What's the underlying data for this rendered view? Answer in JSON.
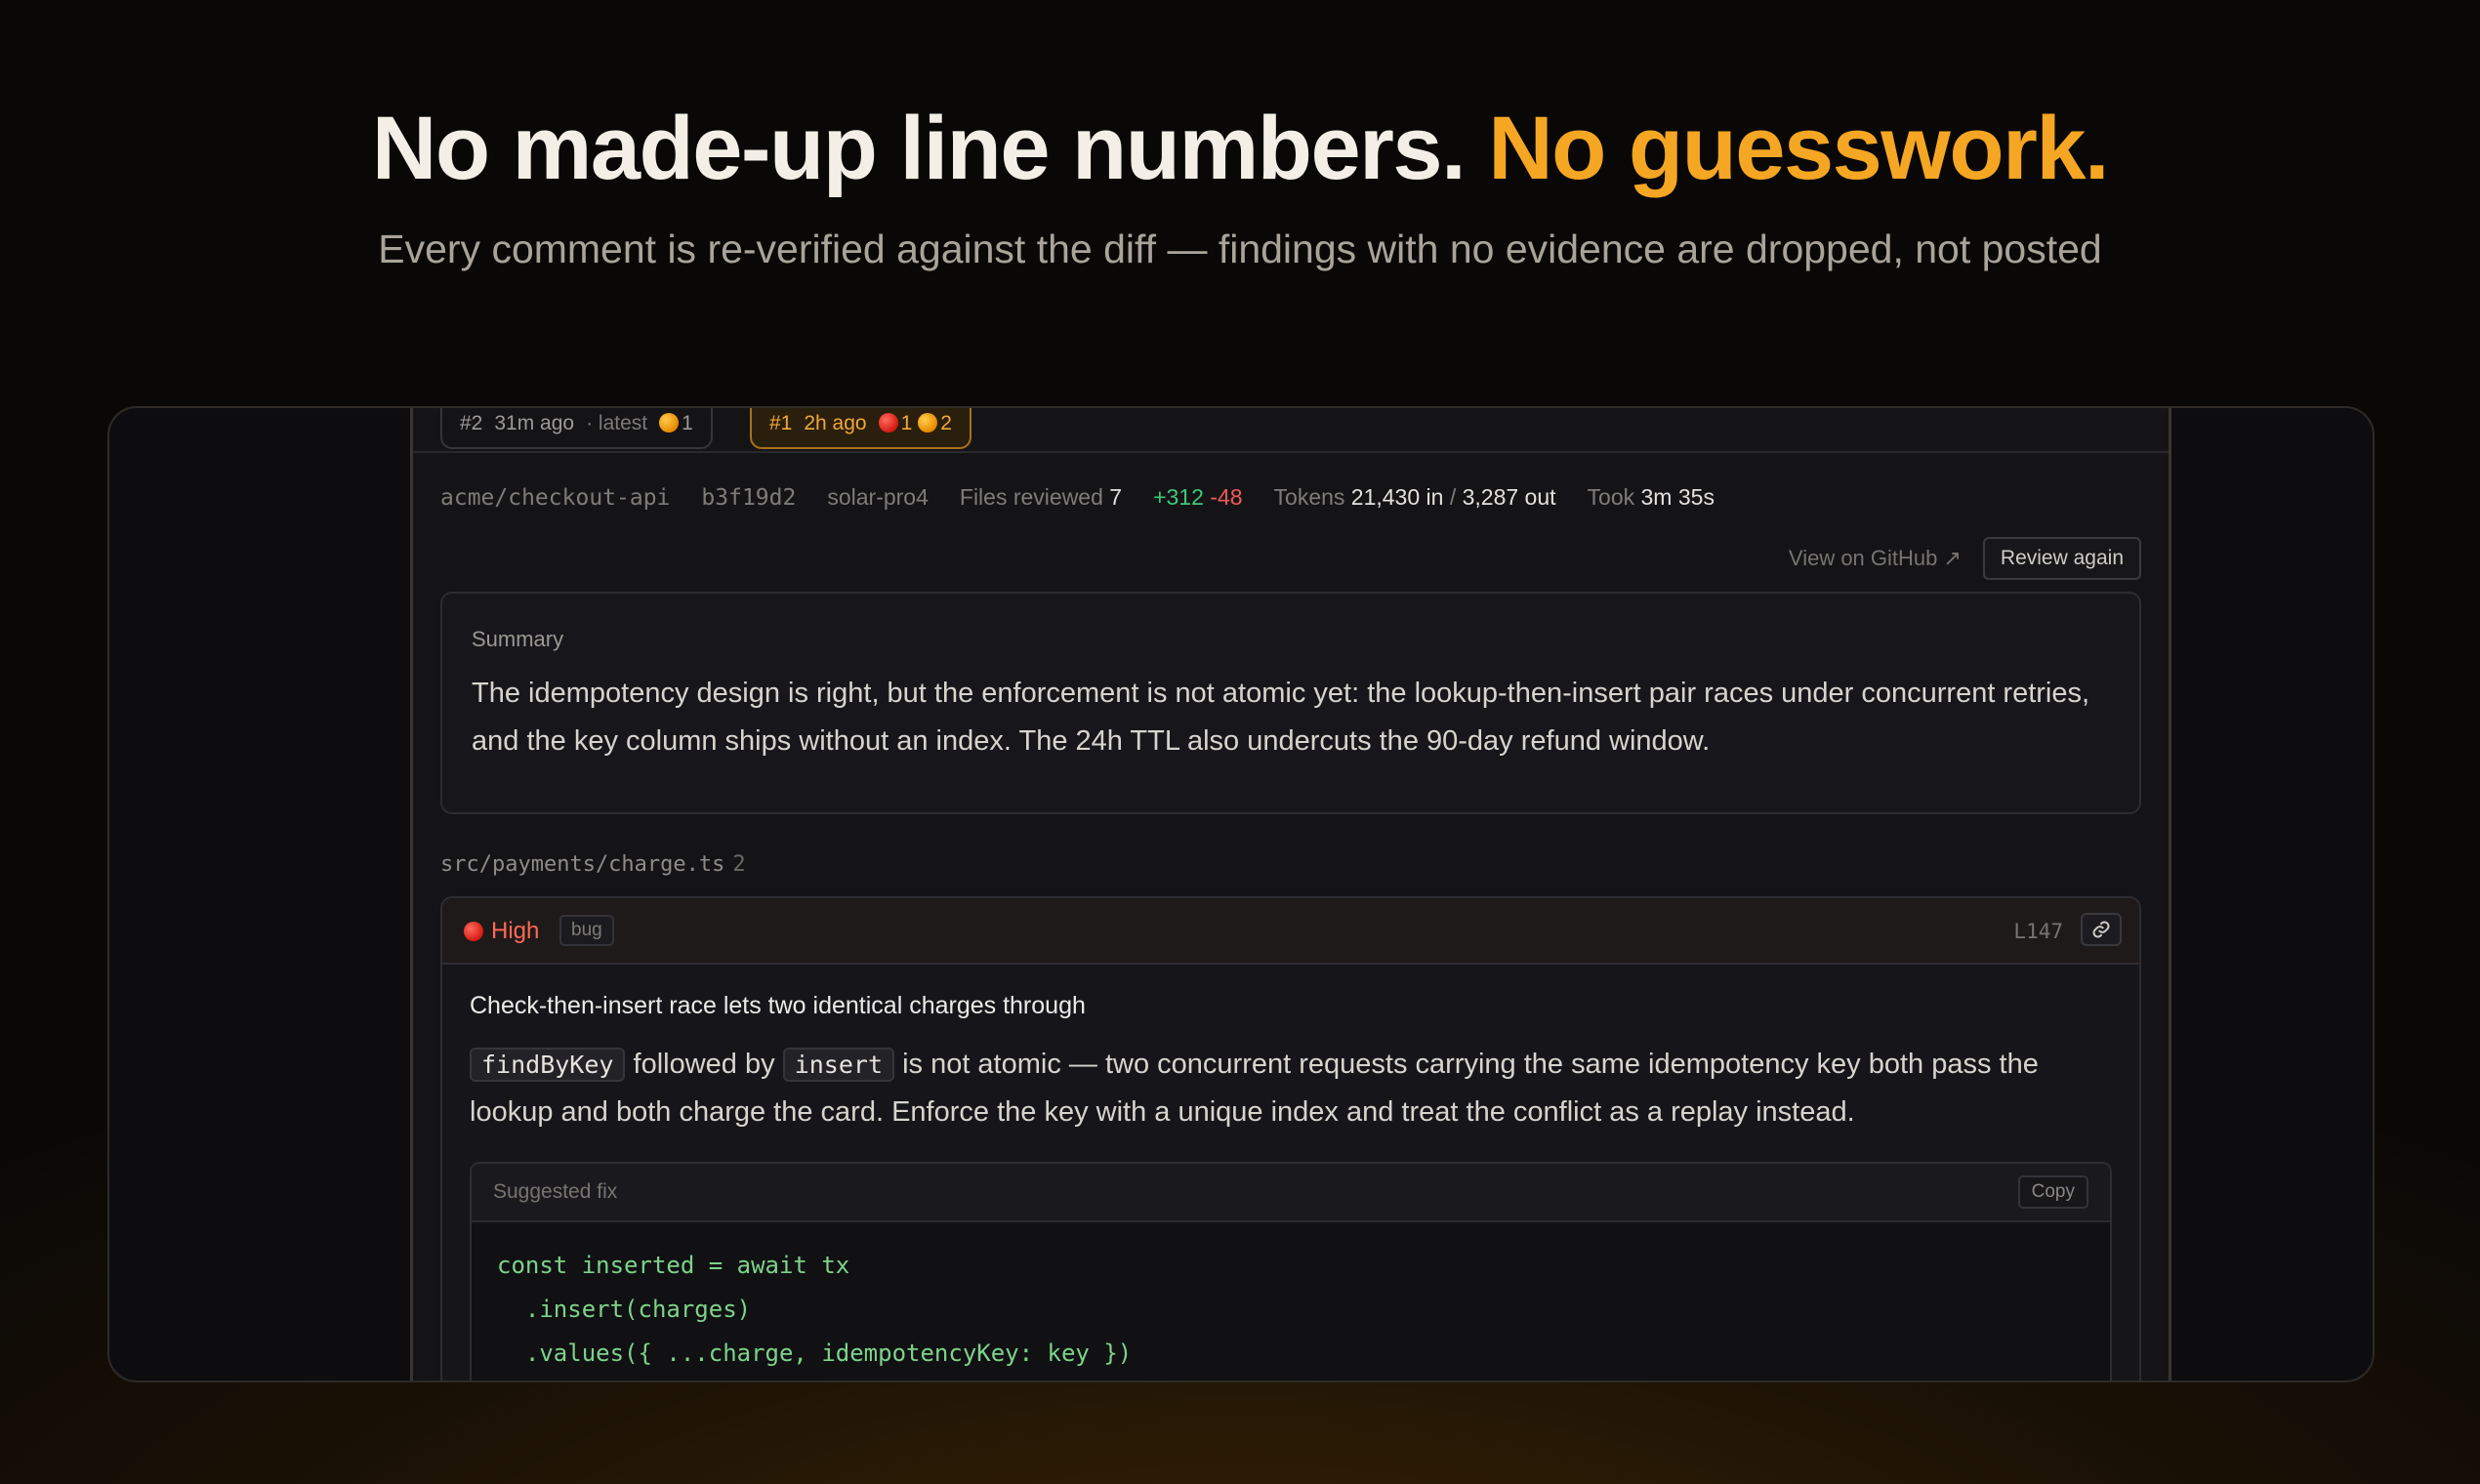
{
  "hero": {
    "headline_main": "No made-up line numbers.",
    "headline_accent": "No guesswork.",
    "subheadline": "Every comment is re-verified against the diff — findings with no evidence are dropped, not posted"
  },
  "runs": [
    {
      "id": "#2",
      "age": "31m ago",
      "note": "· latest",
      "orange_count": "1",
      "active": false
    },
    {
      "id": "#1",
      "age": "2h ago",
      "red_count": "1",
      "orange_count": "2",
      "active": true
    }
  ],
  "meta": {
    "repo": "acme/checkout-api",
    "commit": "b3f19d2",
    "model": "solar-pro4",
    "files_label": "Files reviewed",
    "files_value": "7",
    "additions": "+312",
    "deletions": "-48",
    "tokens_label": "Tokens",
    "tokens_in": "21,430 in",
    "tokens_sep": "/",
    "tokens_out": "3,287 out",
    "took_label": "Took",
    "took_value": "3m 35s"
  },
  "actions": {
    "github_link": "View on GitHub ↗",
    "review_again": "Review again"
  },
  "summary": {
    "label": "Summary",
    "text": "The idempotency design is right, but the enforcement is not atomic yet: the lookup-then-insert pair races under concurrent retries, and the key column ships without an index. The 24h TTL also undercuts the 90-day refund window."
  },
  "file": {
    "path": "src/payments/charge.ts",
    "count": "2"
  },
  "finding": {
    "severity": "High",
    "tag": "bug",
    "line": "L147",
    "title": "Check-then-insert race lets two identical charges through",
    "code_a": "findByKey",
    "text_a": "followed by",
    "code_b": "insert",
    "text_b": "is not atomic — two concurrent requests carrying the same idempotency key both pass the lookup and both charge the card. Enforce the key with a unique index and treat the conflict as a replay instead."
  },
  "fix": {
    "label": "Suggested fix",
    "copy": "Copy",
    "lines": [
      "const inserted = await tx",
      "  .insert(charges)",
      "  .values({ ...charge, idempotencyKey: key })"
    ]
  },
  "colors": {
    "accent": "#f5a623",
    "severity_high": "#ff6a55",
    "additions": "#3fc777",
    "deletions": "#f05a5a",
    "code": "#7dd38a"
  }
}
